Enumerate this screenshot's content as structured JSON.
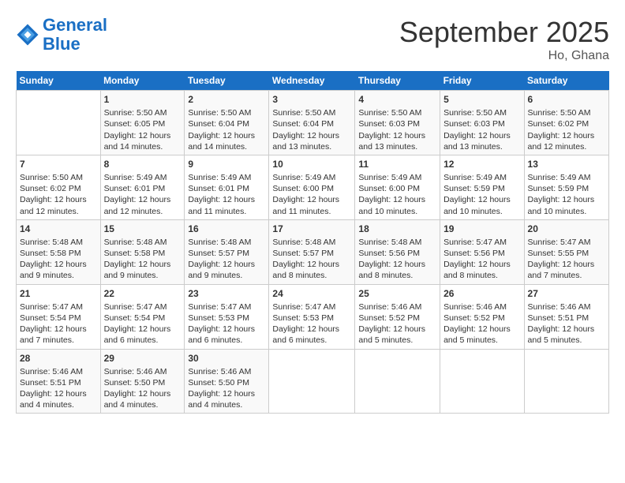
{
  "header": {
    "logo_line1": "General",
    "logo_line2": "Blue",
    "month": "September 2025",
    "location": "Ho, Ghana"
  },
  "weekdays": [
    "Sunday",
    "Monday",
    "Tuesday",
    "Wednesday",
    "Thursday",
    "Friday",
    "Saturday"
  ],
  "weeks": [
    [
      {
        "day": "",
        "sunrise": "",
        "sunset": "",
        "daylight": ""
      },
      {
        "day": "1",
        "sunrise": "Sunrise: 5:50 AM",
        "sunset": "Sunset: 6:05 PM",
        "daylight": "Daylight: 12 hours and 14 minutes."
      },
      {
        "day": "2",
        "sunrise": "Sunrise: 5:50 AM",
        "sunset": "Sunset: 6:04 PM",
        "daylight": "Daylight: 12 hours and 14 minutes."
      },
      {
        "day": "3",
        "sunrise": "Sunrise: 5:50 AM",
        "sunset": "Sunset: 6:04 PM",
        "daylight": "Daylight: 12 hours and 13 minutes."
      },
      {
        "day": "4",
        "sunrise": "Sunrise: 5:50 AM",
        "sunset": "Sunset: 6:03 PM",
        "daylight": "Daylight: 12 hours and 13 minutes."
      },
      {
        "day": "5",
        "sunrise": "Sunrise: 5:50 AM",
        "sunset": "Sunset: 6:03 PM",
        "daylight": "Daylight: 12 hours and 13 minutes."
      },
      {
        "day": "6",
        "sunrise": "Sunrise: 5:50 AM",
        "sunset": "Sunset: 6:02 PM",
        "daylight": "Daylight: 12 hours and 12 minutes."
      }
    ],
    [
      {
        "day": "7",
        "sunrise": "Sunrise: 5:50 AM",
        "sunset": "Sunset: 6:02 PM",
        "daylight": "Daylight: 12 hours and 12 minutes."
      },
      {
        "day": "8",
        "sunrise": "Sunrise: 5:49 AM",
        "sunset": "Sunset: 6:01 PM",
        "daylight": "Daylight: 12 hours and 12 minutes."
      },
      {
        "day": "9",
        "sunrise": "Sunrise: 5:49 AM",
        "sunset": "Sunset: 6:01 PM",
        "daylight": "Daylight: 12 hours and 11 minutes."
      },
      {
        "day": "10",
        "sunrise": "Sunrise: 5:49 AM",
        "sunset": "Sunset: 6:00 PM",
        "daylight": "Daylight: 12 hours and 11 minutes."
      },
      {
        "day": "11",
        "sunrise": "Sunrise: 5:49 AM",
        "sunset": "Sunset: 6:00 PM",
        "daylight": "Daylight: 12 hours and 10 minutes."
      },
      {
        "day": "12",
        "sunrise": "Sunrise: 5:49 AM",
        "sunset": "Sunset: 5:59 PM",
        "daylight": "Daylight: 12 hours and 10 minutes."
      },
      {
        "day": "13",
        "sunrise": "Sunrise: 5:49 AM",
        "sunset": "Sunset: 5:59 PM",
        "daylight": "Daylight: 12 hours and 10 minutes."
      }
    ],
    [
      {
        "day": "14",
        "sunrise": "Sunrise: 5:48 AM",
        "sunset": "Sunset: 5:58 PM",
        "daylight": "Daylight: 12 hours and 9 minutes."
      },
      {
        "day": "15",
        "sunrise": "Sunrise: 5:48 AM",
        "sunset": "Sunset: 5:58 PM",
        "daylight": "Daylight: 12 hours and 9 minutes."
      },
      {
        "day": "16",
        "sunrise": "Sunrise: 5:48 AM",
        "sunset": "Sunset: 5:57 PM",
        "daylight": "Daylight: 12 hours and 9 minutes."
      },
      {
        "day": "17",
        "sunrise": "Sunrise: 5:48 AM",
        "sunset": "Sunset: 5:57 PM",
        "daylight": "Daylight: 12 hours and 8 minutes."
      },
      {
        "day": "18",
        "sunrise": "Sunrise: 5:48 AM",
        "sunset": "Sunset: 5:56 PM",
        "daylight": "Daylight: 12 hours and 8 minutes."
      },
      {
        "day": "19",
        "sunrise": "Sunrise: 5:47 AM",
        "sunset": "Sunset: 5:56 PM",
        "daylight": "Daylight: 12 hours and 8 minutes."
      },
      {
        "day": "20",
        "sunrise": "Sunrise: 5:47 AM",
        "sunset": "Sunset: 5:55 PM",
        "daylight": "Daylight: 12 hours and 7 minutes."
      }
    ],
    [
      {
        "day": "21",
        "sunrise": "Sunrise: 5:47 AM",
        "sunset": "Sunset: 5:54 PM",
        "daylight": "Daylight: 12 hours and 7 minutes."
      },
      {
        "day": "22",
        "sunrise": "Sunrise: 5:47 AM",
        "sunset": "Sunset: 5:54 PM",
        "daylight": "Daylight: 12 hours and 6 minutes."
      },
      {
        "day": "23",
        "sunrise": "Sunrise: 5:47 AM",
        "sunset": "Sunset: 5:53 PM",
        "daylight": "Daylight: 12 hours and 6 minutes."
      },
      {
        "day": "24",
        "sunrise": "Sunrise: 5:47 AM",
        "sunset": "Sunset: 5:53 PM",
        "daylight": "Daylight: 12 hours and 6 minutes."
      },
      {
        "day": "25",
        "sunrise": "Sunrise: 5:46 AM",
        "sunset": "Sunset: 5:52 PM",
        "daylight": "Daylight: 12 hours and 5 minutes."
      },
      {
        "day": "26",
        "sunrise": "Sunrise: 5:46 AM",
        "sunset": "Sunset: 5:52 PM",
        "daylight": "Daylight: 12 hours and 5 minutes."
      },
      {
        "day": "27",
        "sunrise": "Sunrise: 5:46 AM",
        "sunset": "Sunset: 5:51 PM",
        "daylight": "Daylight: 12 hours and 5 minutes."
      }
    ],
    [
      {
        "day": "28",
        "sunrise": "Sunrise: 5:46 AM",
        "sunset": "Sunset: 5:51 PM",
        "daylight": "Daylight: 12 hours and 4 minutes."
      },
      {
        "day": "29",
        "sunrise": "Sunrise: 5:46 AM",
        "sunset": "Sunset: 5:50 PM",
        "daylight": "Daylight: 12 hours and 4 minutes."
      },
      {
        "day": "30",
        "sunrise": "Sunrise: 5:46 AM",
        "sunset": "Sunset: 5:50 PM",
        "daylight": "Daylight: 12 hours and 4 minutes."
      },
      {
        "day": "",
        "sunrise": "",
        "sunset": "",
        "daylight": ""
      },
      {
        "day": "",
        "sunrise": "",
        "sunset": "",
        "daylight": ""
      },
      {
        "day": "",
        "sunrise": "",
        "sunset": "",
        "daylight": ""
      },
      {
        "day": "",
        "sunrise": "",
        "sunset": "",
        "daylight": ""
      }
    ]
  ]
}
